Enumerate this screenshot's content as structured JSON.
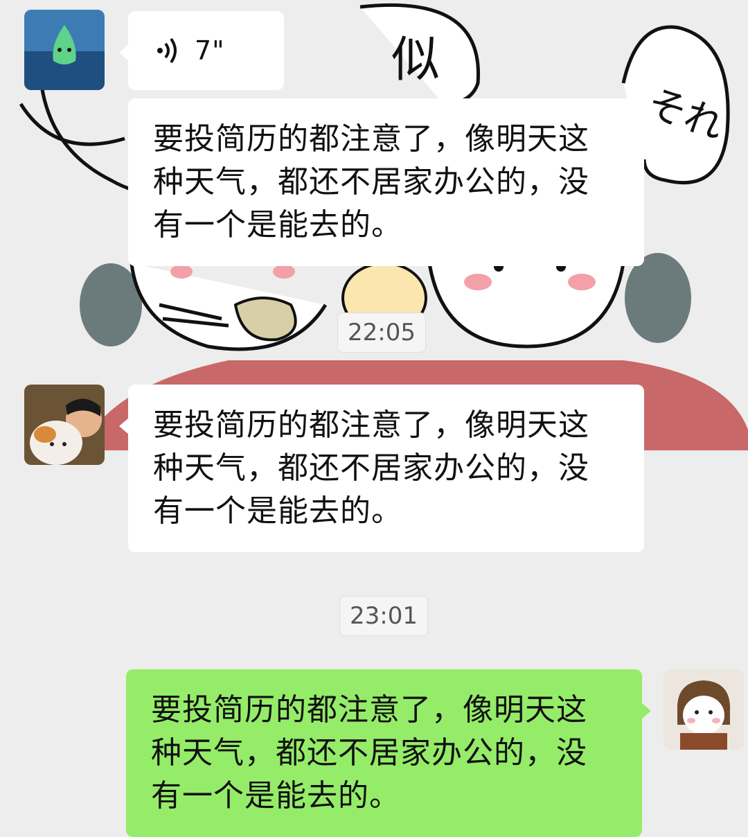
{
  "chat": {
    "messages": [
      {
        "kind": "voice",
        "side": "left",
        "duration": "7\""
      },
      {
        "kind": "text",
        "side": "left",
        "text": "要投简历的都注意了，像明天这种天气，都还不居家办公的，没有一个是能去的。"
      }
    ],
    "timestamps": [
      "22:05",
      "23:01"
    ],
    "later_messages": [
      {
        "kind": "text",
        "side": "left",
        "text": "要投简历的都注意了，像明天这种天气，都还不居家办公的，没有一个是能去的。"
      },
      {
        "kind": "text",
        "side": "right",
        "text": "要投简历的都注意了，像明天这种天气，都还不居家办公的，没有一个是能去的。"
      }
    ]
  },
  "background": {
    "sticker_text_1": "似",
    "sticker_text_2": "それ"
  },
  "colors": {
    "self_bubble": "#95ec69",
    "other_bubble": "#ffffff",
    "chat_bg": "#ededed",
    "table_red": "#c96868"
  }
}
